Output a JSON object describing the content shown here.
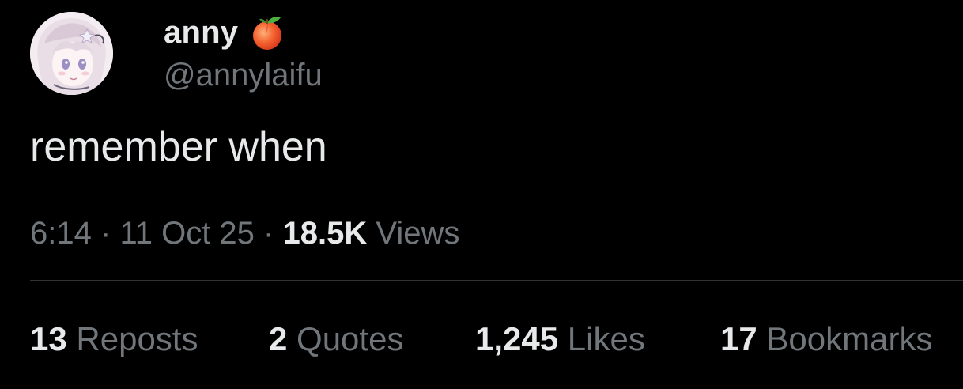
{
  "tweet": {
    "author": {
      "display_name": "anny",
      "emoji_icon": "peach-icon",
      "handle": "@annylaifu",
      "avatar": "anime-girl-avatar"
    },
    "text": "remember when",
    "meta": {
      "time": "6:14",
      "separator": "·",
      "date": "11 Oct 25",
      "views_count": "18.5K",
      "views_label": "Views"
    },
    "stats": [
      {
        "count": "13",
        "label": "Reposts"
      },
      {
        "count": "2",
        "label": "Quotes"
      },
      {
        "count": "1,245",
        "label": "Likes"
      },
      {
        "count": "17",
        "label": "Bookmarks"
      }
    ]
  },
  "colors": {
    "background": "#000000",
    "primary_text": "#e7e9ea",
    "secondary_text": "#71767b",
    "divider": "#2f3336"
  }
}
